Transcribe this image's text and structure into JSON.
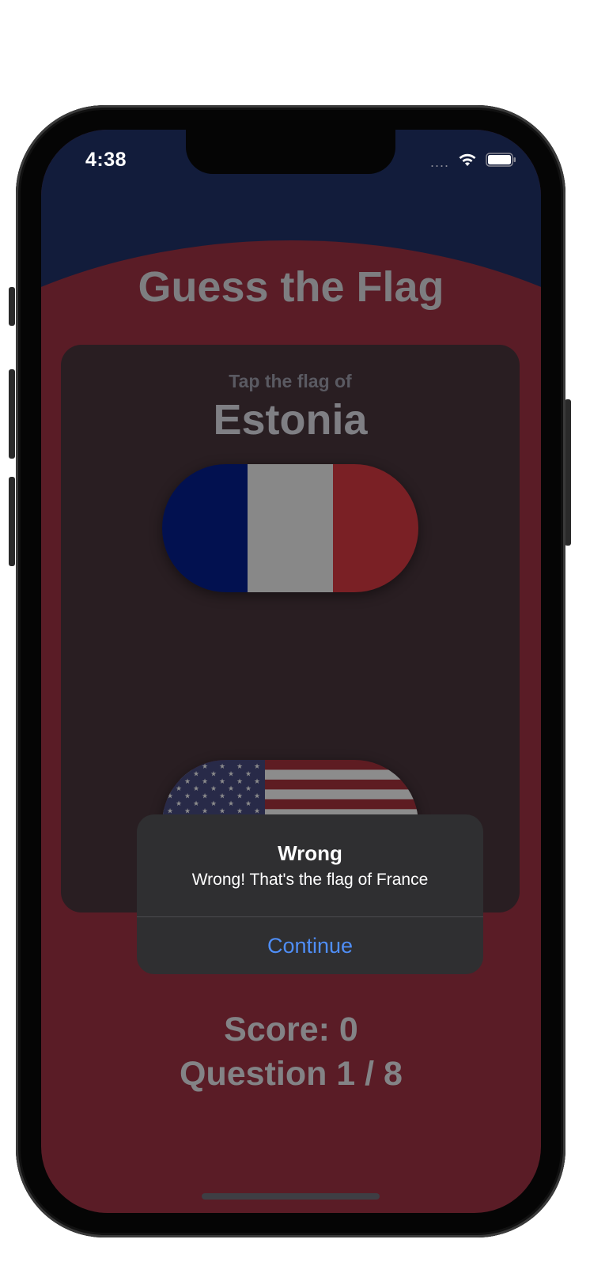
{
  "status_bar": {
    "time": "4:38",
    "signal": "....",
    "wifi_icon": "wifi-icon",
    "battery_icon": "battery-icon"
  },
  "app": {
    "title": "Guess the Flag",
    "prompt": "Tap the flag of",
    "country": "Estonia",
    "score": "Score: 0",
    "question": "Question 1 / 8"
  },
  "flags": [
    {
      "name": "France",
      "colors": [
        "#021150",
        "#888888",
        "#7a2025"
      ]
    },
    {
      "name": "United States",
      "colors": [
        "#5e1c22",
        "#8c8c8c",
        "#282a48"
      ]
    }
  ],
  "alert": {
    "title": "Wrong",
    "message": "Wrong! That's the flag of France",
    "button": "Continue"
  },
  "colors": {
    "background_top": "#121c3b",
    "background_bottom": "#5a1c26",
    "accent": "#4f8ef7"
  }
}
